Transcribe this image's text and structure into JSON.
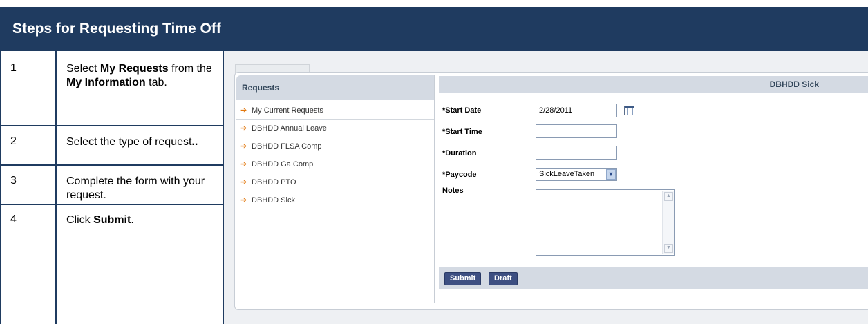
{
  "title": "Steps for Requesting Time Off",
  "steps": [
    {
      "number": "1",
      "parts": [
        {
          "text": "Select ",
          "bold": false
        },
        {
          "text": "My Requests",
          "bold": true
        },
        {
          "text": " from the ",
          "bold": false
        },
        {
          "text": "My Information",
          "bold": true
        },
        {
          "text": " tab.",
          "bold": false
        }
      ]
    },
    {
      "number": "2",
      "parts": [
        {
          "text": "Select the type of request",
          "bold": false
        },
        {
          "text": "..",
          "bold": true
        }
      ]
    },
    {
      "number": "3",
      "parts": [
        {
          "text": "Complete the form with your request.",
          "bold": false
        }
      ]
    },
    {
      "number": "4",
      "parts": [
        {
          "text": "Click ",
          "bold": false
        },
        {
          "text": "Submit",
          "bold": true
        },
        {
          "text": ".",
          "bold": false
        }
      ]
    }
  ],
  "screenshot": {
    "left_header": "Requests",
    "menu_items": [
      "My Current Requests",
      "DBHDD Annual Leave",
      "DBHDD FLSA Comp",
      "DBHDD Ga Comp",
      "DBHDD PTO",
      "DBHDD Sick"
    ],
    "right_header": "DBHDD Sick",
    "form": {
      "start_date_label": "*Start Date",
      "start_date_value": "2/28/2011",
      "start_time_label": "*Start Time",
      "start_time_value": "",
      "duration_label": "*Duration",
      "duration_value": "",
      "paycode_label": "*Paycode",
      "paycode_value": "SickLeaveTaken",
      "notes_label": "Notes"
    },
    "buttons": {
      "submit": "Submit",
      "draft": "Draft"
    },
    "icons": {
      "calendar": "calendar-icon",
      "dropdown": "chevron-down-icon",
      "menu_arrow": "arrow-right-icon"
    },
    "colors": {
      "header_blue": "#1f3b60",
      "arrow_orange": "#e2780e",
      "button_blue": "#3d4f82"
    }
  }
}
